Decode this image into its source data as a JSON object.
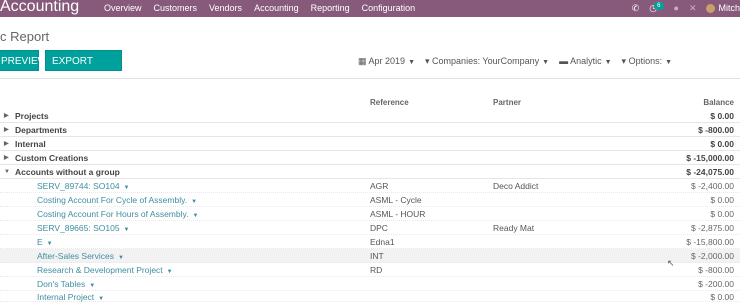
{
  "topbar": {
    "app_title": "Accounting",
    "menu": [
      "Overview",
      "Customers",
      "Vendors",
      "Accounting",
      "Reporting",
      "Configuration"
    ],
    "activity_count": "6",
    "user_name": "Mitch",
    "bg_color": "#875a7b"
  },
  "page": {
    "breadcrumb": "c Report"
  },
  "buttons": {
    "preview": "PREVIEW",
    "export": "EXPORT (XLSX)"
  },
  "filters": {
    "date": "Apr 2019",
    "companies": "Companies: YourCompany",
    "analytic": "Analytic",
    "options": "Options:"
  },
  "table": {
    "headers": {
      "reference": "Reference",
      "partner": "Partner",
      "balance": "Balance"
    },
    "groups": [
      {
        "label": "Projects",
        "balance": "$ 0.00"
      },
      {
        "label": "Departments",
        "balance": "$ -800.00"
      },
      {
        "label": "Internal",
        "balance": "$ 0.00"
      },
      {
        "label": "Custom Creations",
        "balance": "$ -15,000.00"
      },
      {
        "label": "Accounts without a group",
        "balance": "$ -24,075.00"
      }
    ],
    "accounts": [
      {
        "name": "SERV_89744: SO104",
        "ref": "AGR",
        "partner": "Deco Addict",
        "balance": "$ -2,400.00"
      },
      {
        "name": "Costing Account For Cycle of Assembly.",
        "ref": "ASML - Cycle",
        "partner": "",
        "balance": "$ 0.00"
      },
      {
        "name": "Costing Account For Hours of Assembly.",
        "ref": "ASML - HOUR",
        "partner": "",
        "balance": "$ 0.00"
      },
      {
        "name": "SERV_89665: SO105",
        "ref": "DPC",
        "partner": "Ready Mat",
        "balance": "$ -2,875.00"
      },
      {
        "name": "E",
        "ref": "Edna1",
        "partner": "",
        "balance": "$ -15,800.00"
      },
      {
        "name": "After-Sales Services",
        "ref": "INT",
        "partner": "",
        "balance": "$ -2,000.00"
      },
      {
        "name": "Research & Development Project",
        "ref": "RD",
        "partner": "",
        "balance": "$ -800.00"
      },
      {
        "name": "Don's Tables",
        "ref": "",
        "partner": "",
        "balance": "$ -200.00"
      },
      {
        "name": "Internal Project",
        "ref": "",
        "partner": "",
        "balance": "$ 0.00"
      }
    ]
  }
}
